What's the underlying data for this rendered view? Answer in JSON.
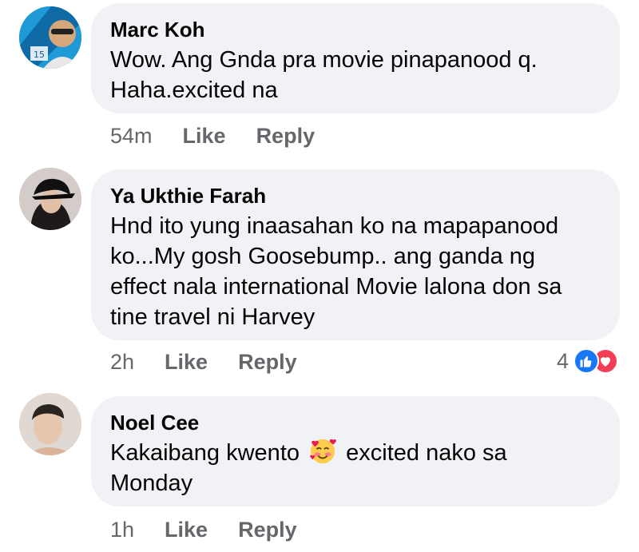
{
  "comments": [
    {
      "author": "Marc Koh",
      "text_lines": [
        "Wow. Ang Gnda pra movie pinapanood q.",
        "Haha.excited na"
      ],
      "time": "54m",
      "like_label": "Like",
      "reply_label": "Reply",
      "avatar_badge": "15"
    },
    {
      "author": "Ya Ukthie Farah",
      "text_lines": [
        "Hnd ito yung inaasahan ko na mapapanood",
        "ko...My gosh Goosebump.. ang ganda ng",
        "effect nala international Movie lalona don sa",
        "tine travel ni Harvey"
      ],
      "time": "2h",
      "like_label": "Like",
      "reply_label": "Reply",
      "reaction_count": "4",
      "reaction_icons": [
        "like-icon",
        "love-icon"
      ],
      "colors": {
        "like": "#1877f2",
        "love": "#f33e58"
      }
    },
    {
      "author": "Noel Cee",
      "text_before_emoji": "Kakaibang kwento",
      "emoji": "smiling-face-with-hearts-icon",
      "text_after_emoji": "excited nako sa",
      "text_line2": "Monday",
      "time": "1h",
      "like_label": "Like",
      "reply_label": "Reply"
    }
  ]
}
